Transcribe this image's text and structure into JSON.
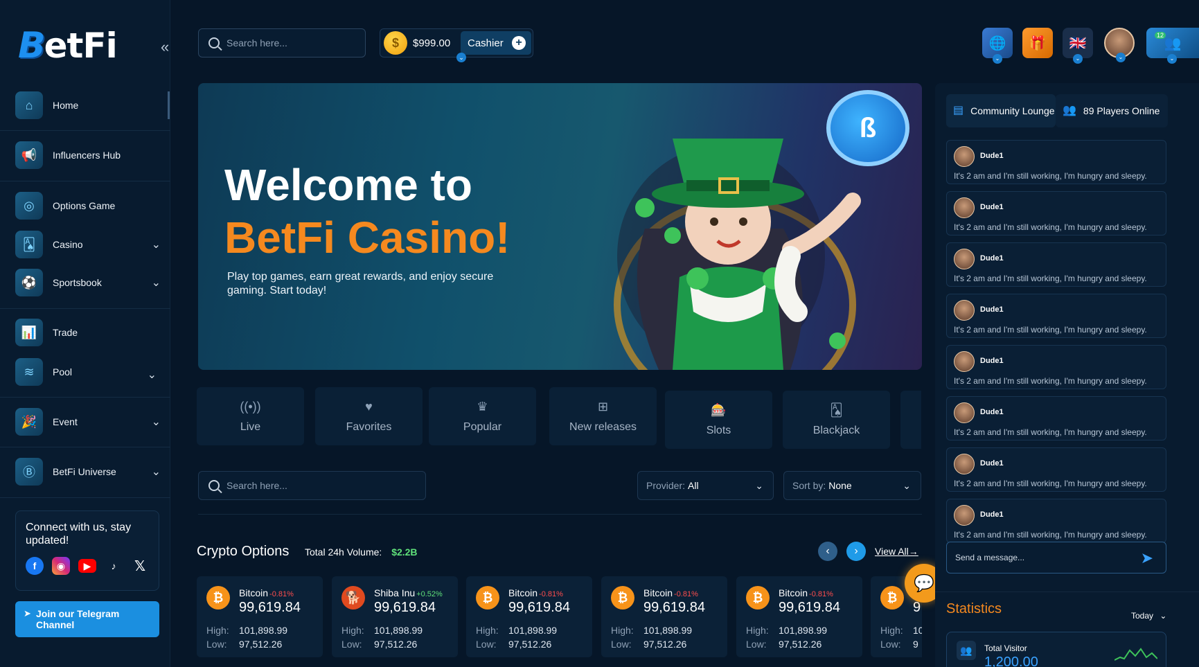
{
  "brand": {
    "logo_b": "B",
    "logo_text": "etFi"
  },
  "sidebar": {
    "items": [
      {
        "label": "Home",
        "icon": "home-icon",
        "expandable": false
      },
      {
        "label": "Influencers Hub",
        "icon": "megaphone-icon",
        "expandable": false
      },
      {
        "label": "Options Game",
        "icon": "options-icon",
        "expandable": false
      },
      {
        "label": "Casino",
        "icon": "casino-icon",
        "expandable": true
      },
      {
        "label": "Sportsbook",
        "icon": "ball-icon",
        "expandable": true
      },
      {
        "label": "Trade",
        "icon": "chart-icon",
        "expandable": false
      },
      {
        "label": "Pool",
        "icon": "pool-icon",
        "expandable": true
      },
      {
        "label": "Event",
        "icon": "event-icon",
        "expandable": true
      },
      {
        "label": "BetFi Universe",
        "icon": "universe-icon",
        "expandable": true
      }
    ],
    "connect_title": "Connect with us, stay updated!",
    "telegram_label": "Join our Telegram Channel"
  },
  "topbar": {
    "search_placeholder": "Search here...",
    "balance": "$999.00",
    "cashier_label": "Cashier",
    "notification_count": "12"
  },
  "hero": {
    "title_line1": "Welcome to",
    "title_line2": "BetFi Casino!",
    "subtitle": "Play top games, earn great rewards, and enjoy secure gaming. Start today!"
  },
  "categories": [
    "Live",
    "Favorites",
    "Popular",
    "New releases",
    "Slots",
    "Blackjack"
  ],
  "filters": {
    "search_placeholder": "Search here...",
    "provider_label": "Provider:",
    "provider_value": "All",
    "sort_label": "Sort by:",
    "sort_value": "None"
  },
  "crypto": {
    "title": "Crypto Options",
    "volume_label": "Total 24h Volume:",
    "volume_value": "$2.2B",
    "view_all": "View All→",
    "cards": [
      {
        "name": "Bitcoin",
        "change": "-0.81%",
        "price": "99,619.84",
        "high": "101,898.99",
        "low": "97,512.26",
        "symbol": "₿"
      },
      {
        "name": "Shiba Inu",
        "change": "+0.52%",
        "price": "99,619.84",
        "high": "101,898.99",
        "low": "97,512.26",
        "symbol": "🐕"
      },
      {
        "name": "Bitcoin",
        "change": "-0.81%",
        "price": "99,619.84",
        "high": "101,898.99",
        "low": "97,512.26",
        "symbol": "₿"
      },
      {
        "name": "Bitcoin",
        "change": "-0.81%",
        "price": "99,619.84",
        "high": "101,898.99",
        "low": "97,512.26",
        "symbol": "₿"
      },
      {
        "name": "Bitcoin",
        "change": "-0.81%",
        "price": "99,619.84",
        "high": "101,898.99",
        "low": "97,512.26",
        "symbol": "₿"
      },
      {
        "name": "",
        "change": "",
        "price": "9",
        "high": "10",
        "low": "9",
        "symbol": "₿"
      }
    ],
    "high_label": "High:",
    "low_label": "Low:"
  },
  "community": {
    "lounge_label": "Community Lounge",
    "players_label": "89 Players Online",
    "messages": [
      {
        "user": "Dude1",
        "text": "It's 2 am and I'm still working, I'm hungry and sleepy."
      },
      {
        "user": "Dude1",
        "text": "It's 2 am and I'm still working, I'm hungry and sleepy."
      },
      {
        "user": "Dude1",
        "text": "It's 2 am and I'm still working, I'm hungry and sleepy."
      },
      {
        "user": "Dude1",
        "text": "It's 2 am and I'm still working, I'm hungry and sleepy."
      },
      {
        "user": "Dude1",
        "text": "It's 2 am and I'm still working, I'm hungry and sleepy."
      },
      {
        "user": "Dude1",
        "text": "It's 2 am and I'm still working, I'm hungry and sleepy."
      },
      {
        "user": "Dude1",
        "text": "It's 2 am and I'm still working, I'm hungry and sleepy."
      },
      {
        "user": "Dude1",
        "text": "It's 2 am and I'm still working, I'm hungry and sleepy."
      }
    ],
    "send_placeholder": "Send a message..."
  },
  "statistics": {
    "title": "Statistics",
    "period": "Today",
    "total_visitor_label": "Total Visitor",
    "total_visitor_value": "1,200.00"
  },
  "colors": {
    "accent_orange": "#f5891f",
    "accent_blue": "#1b8fe0",
    "positive": "#5fe07a",
    "negative": "#ff4d4d"
  }
}
